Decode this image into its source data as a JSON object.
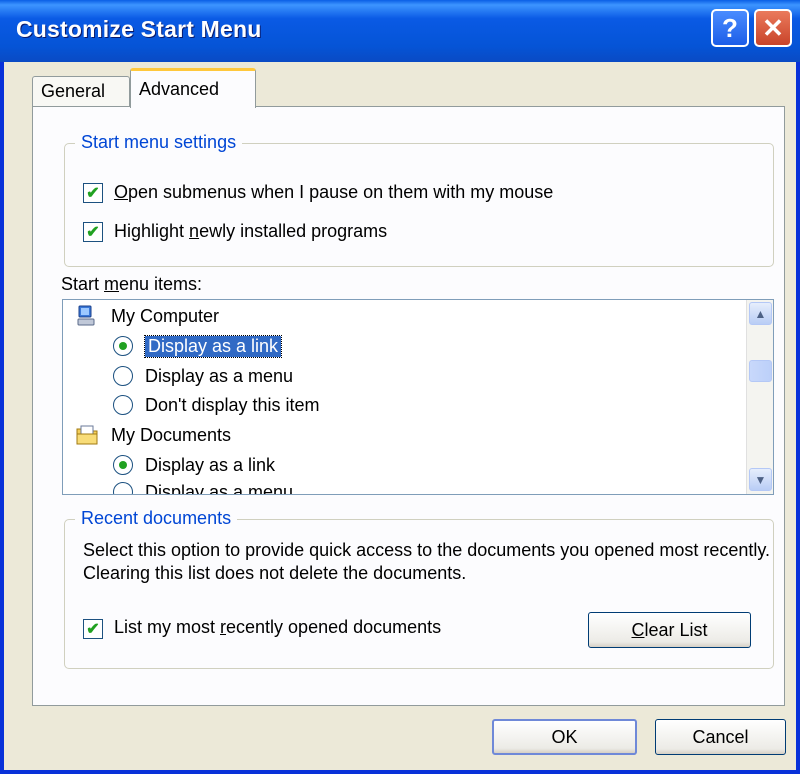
{
  "window": {
    "title": "Customize Start Menu",
    "help_button": "?",
    "close_button": "✕"
  },
  "tabs": [
    {
      "label": "General"
    },
    {
      "label": "Advanced"
    }
  ],
  "start_menu_settings": {
    "legend": "Start menu settings",
    "open_submenus": {
      "prefix": "",
      "mnemonic": "O",
      "suffix": "pen submenus when I pause on them with my mouse",
      "checked": true
    },
    "highlight_programs": {
      "prefix": "Highlight ",
      "mnemonic": "n",
      "suffix": "ewly installed programs",
      "checked": true
    }
  },
  "start_menu_items": {
    "label_prefix": "Start ",
    "label_mnemonic": "m",
    "label_suffix": "enu items:",
    "items": [
      {
        "label": "My Computer",
        "icon": "my-computer-icon"
      },
      {
        "label": "Display as a link",
        "selected": true
      },
      {
        "label": "Display as a menu",
        "selected": false
      },
      {
        "label": "Don't display this item",
        "selected": false
      },
      {
        "label": "My Documents",
        "icon": "my-documents-icon"
      },
      {
        "label": "Display as a link",
        "selected": true
      },
      {
        "label": "Display as a menu",
        "selected": false
      }
    ]
  },
  "recent_documents": {
    "legend": "Recent documents",
    "description": "Select this option to provide quick access to the documents you opened most recently.  Clearing this list does not delete the documents.",
    "list_recent": {
      "prefix": "List my most ",
      "mnemonic": "r",
      "suffix": "ecently opened documents",
      "checked": true
    },
    "clear_button": {
      "mnemonic": "C",
      "suffix": "lear List"
    }
  },
  "footer": {
    "ok_label": "OK",
    "cancel_label": "Cancel"
  },
  "colors": {
    "titlebar": "#0554d6",
    "legend_text": "#0046d5",
    "selection": "#316ac5",
    "check": "#21a121"
  }
}
